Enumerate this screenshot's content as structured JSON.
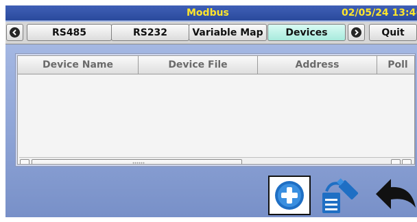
{
  "header": {
    "title": "Modbus",
    "datetime": "02/05/24 13:4("
  },
  "tabs": [
    {
      "label": "RS485",
      "active": false
    },
    {
      "label": "RS232",
      "active": false
    },
    {
      "label": "Variable Map",
      "active": false
    },
    {
      "label": "Devices",
      "active": true
    },
    {
      "label": "Quit",
      "active": false
    }
  ],
  "table": {
    "columns": [
      "Device Name",
      "Device File",
      "Address",
      "Poll"
    ],
    "rows": []
  },
  "toolbar": {
    "icons": [
      "add-device-icon",
      "import-from-usb-icon",
      "back-arrow-icon"
    ]
  },
  "colors": {
    "title_text": "#ffe62b",
    "title_bar": "#2f4fa3",
    "active_tab": "#b8efe3",
    "add_icon": "#1f73c9"
  }
}
